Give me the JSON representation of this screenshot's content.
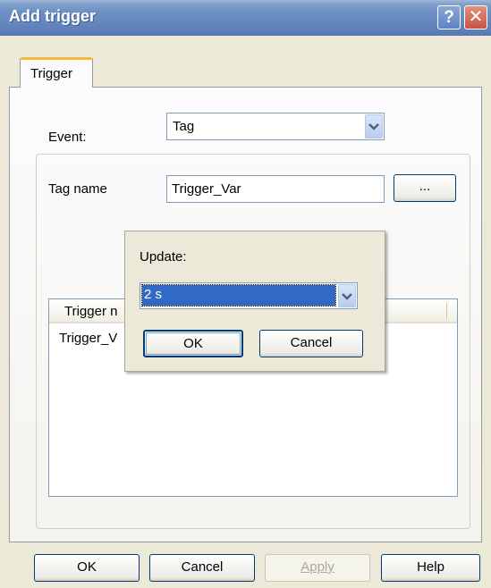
{
  "window": {
    "title": "Add trigger"
  },
  "titlebar": {
    "help_glyph": "?",
    "close_glyph": "✕"
  },
  "tabs": [
    {
      "label": "Trigger",
      "active": true
    }
  ],
  "form": {
    "event_label": "Event:",
    "event_value": "Tag",
    "tag_name_label": "Tag name",
    "tag_name_value": "Trigger_Var",
    "browse_label": "..."
  },
  "list": {
    "column_header": "Trigger n",
    "rows": [
      "Trigger_V"
    ]
  },
  "update_popup": {
    "label": "Update:",
    "selected_value": "2 s",
    "ok_label": "OK",
    "cancel_label": "Cancel"
  },
  "footer": {
    "ok_label": "OK",
    "cancel_label": "Cancel",
    "apply_label": "Apply",
    "apply_disabled": true,
    "help_label": "Help"
  },
  "colors": {
    "titlebar": "#6688c0",
    "dialog_bg": "#ece9d8",
    "tab_accent": "#f4ba3c",
    "selection": "#316ac5",
    "button_border": "#003c74"
  },
  "icons": [
    "help-icon",
    "close-icon",
    "chevron-down-icon"
  ]
}
